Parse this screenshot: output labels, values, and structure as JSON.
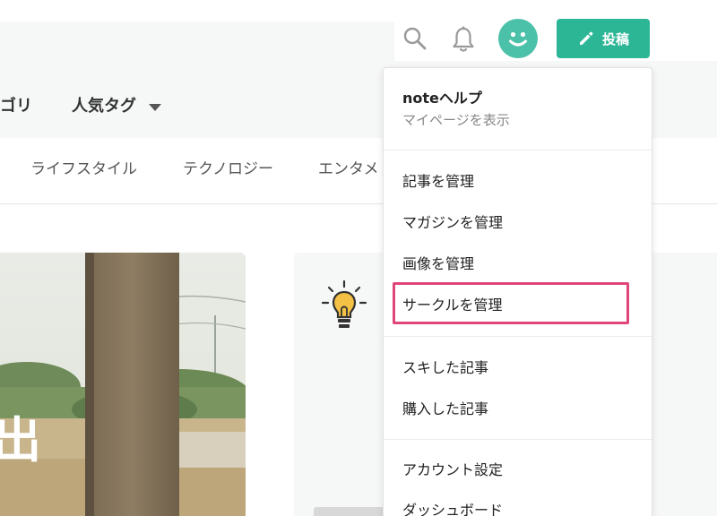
{
  "header": {
    "post_label": "投稿",
    "icons": {
      "search": "search-icon",
      "notifications": "bell-icon",
      "avatar": "smiley-avatar-icon",
      "post": "pencil-icon"
    },
    "colors": {
      "brand": "#2cb696",
      "avatar": "#4cc1aa"
    }
  },
  "category_nav": {
    "category_label": "ゴリ",
    "popular_tags_label": "人気タグ"
  },
  "genre_tabs": [
    "ライフスタイル",
    "テクノロジー",
    "エンタメ"
  ],
  "photo_card": {
    "overlay_text": "出"
  },
  "menu": {
    "title": "noteヘルプ",
    "subtitle": "マイページを表示",
    "group1": [
      "記事を管理",
      "マガジンを管理",
      "画像を管理",
      "サークルを管理"
    ],
    "group2": [
      "スキした記事",
      "購入した記事"
    ],
    "group3": [
      "アカウント設定",
      "ダッシュボード"
    ],
    "highlight_color": "#e0457b"
  }
}
